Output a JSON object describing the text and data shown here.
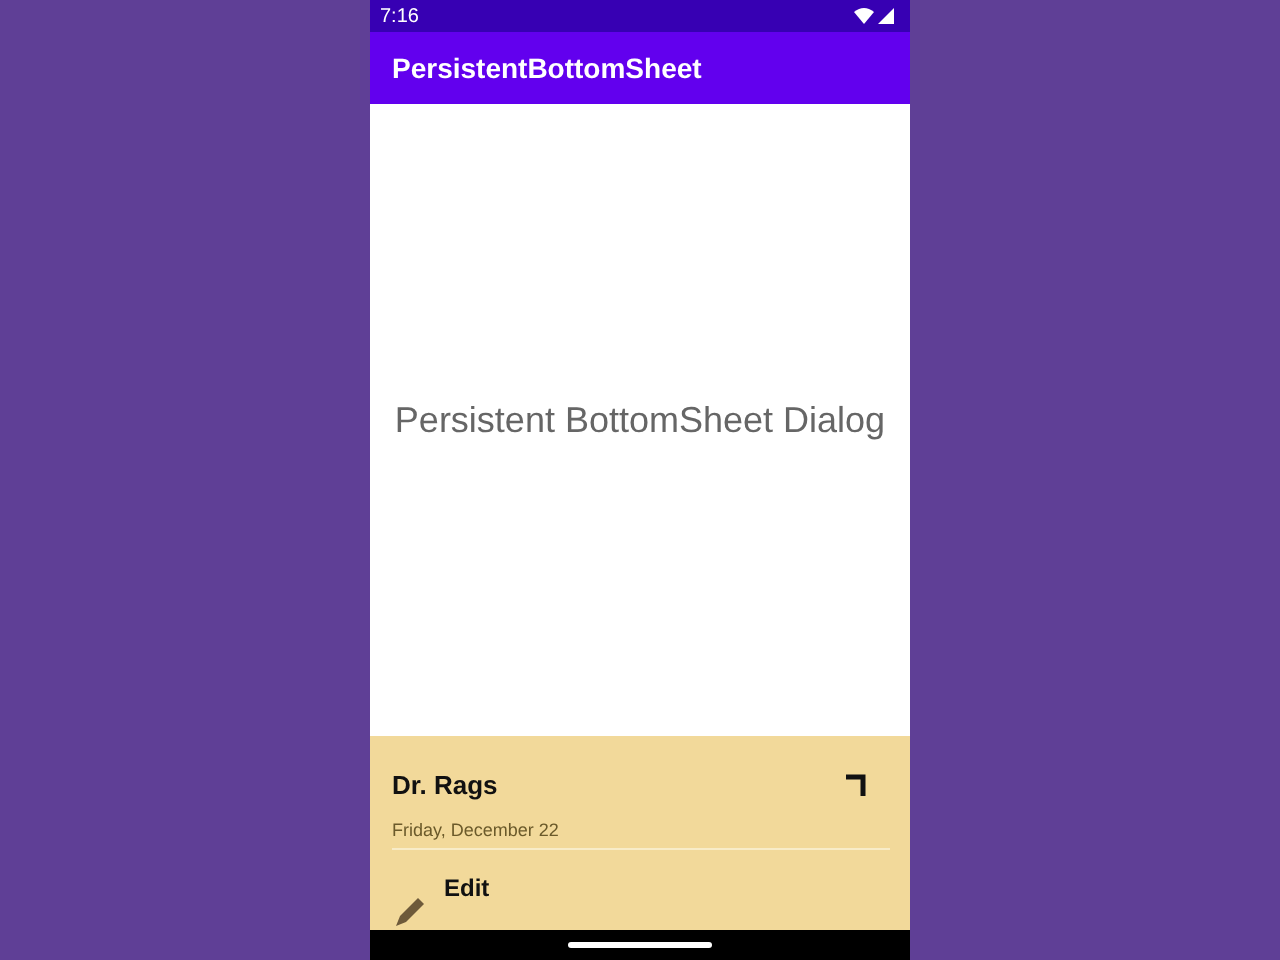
{
  "status_bar": {
    "time": "7:16"
  },
  "app_bar": {
    "title": "PersistentBottomSheet"
  },
  "content": {
    "text": "Persistent BottomSheet Dialog"
  },
  "bottom_sheet": {
    "title": "Dr. Rags",
    "date": "Friday, December 22",
    "items": [
      {
        "label": "Edit"
      }
    ]
  }
}
